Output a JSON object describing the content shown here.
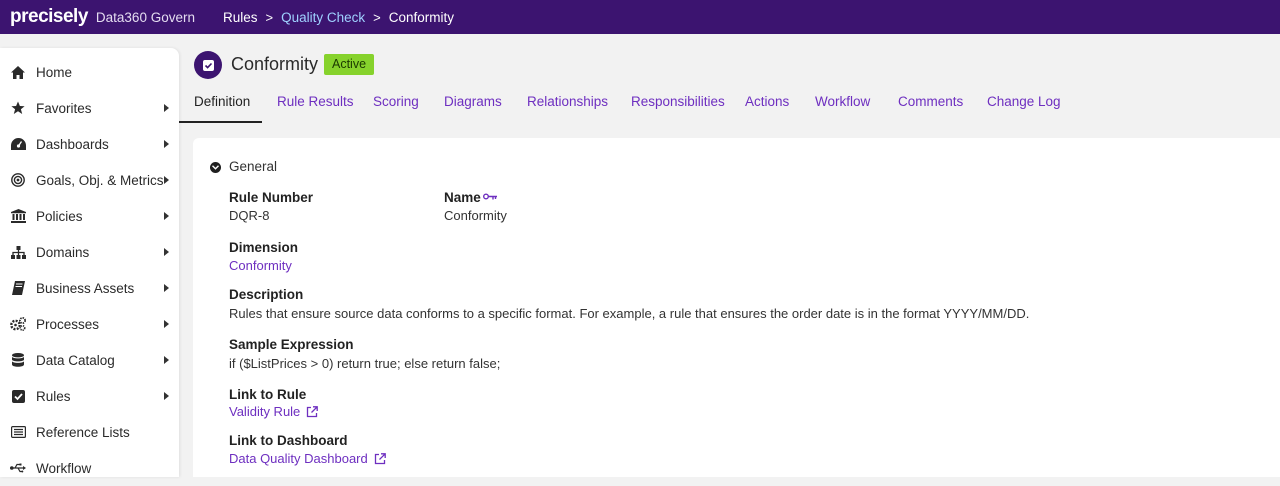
{
  "topbar": {
    "logo": "precisely",
    "product": "Data360 Govern",
    "breadcrumbs": [
      {
        "label": "Rules"
      },
      {
        "label": "Quality Check"
      },
      {
        "label": "Conformity"
      }
    ],
    "separator": ">"
  },
  "sidebar": {
    "items": [
      {
        "label": "Home",
        "icon": "home-icon",
        "has_submenu": false
      },
      {
        "label": "Favorites",
        "icon": "star-icon",
        "has_submenu": true
      },
      {
        "label": "Dashboards",
        "icon": "dashboard-icon",
        "has_submenu": true
      },
      {
        "label": "Goals, Obj. & Metrics",
        "icon": "target-icon",
        "has_submenu": true
      },
      {
        "label": "Policies",
        "icon": "bank-icon",
        "has_submenu": true
      },
      {
        "label": "Domains",
        "icon": "hierarchy-icon",
        "has_submenu": true
      },
      {
        "label": "Business Assets",
        "icon": "book-icon",
        "has_submenu": true
      },
      {
        "label": "Processes",
        "icon": "gears-icon",
        "has_submenu": true
      },
      {
        "label": "Data Catalog",
        "icon": "database-icon",
        "has_submenu": true
      },
      {
        "label": "Rules",
        "icon": "checkbox-icon",
        "has_submenu": true
      },
      {
        "label": "Reference Lists",
        "icon": "list-icon",
        "has_submenu": false
      },
      {
        "label": "Workflow",
        "icon": "usb-icon",
        "has_submenu": false
      }
    ]
  },
  "header": {
    "title": "Conformity",
    "status": "Active",
    "icon": "checkbox-icon"
  },
  "tabs": [
    {
      "label": "Definition",
      "active": true
    },
    {
      "label": "Rule Results",
      "active": false
    },
    {
      "label": "Scoring",
      "active": false
    },
    {
      "label": "Diagrams",
      "active": false
    },
    {
      "label": "Relationships",
      "active": false
    },
    {
      "label": "Responsibilities",
      "active": false
    },
    {
      "label": "Actions",
      "active": false
    },
    {
      "label": "Workflow",
      "active": false
    },
    {
      "label": "Comments",
      "active": false
    },
    {
      "label": "Change Log",
      "active": false
    }
  ],
  "general": {
    "section_title": "General",
    "rule_number_label": "Rule Number",
    "rule_number": "DQR-8",
    "name_label": "Name",
    "name": "Conformity",
    "dimension_label": "Dimension",
    "dimension": "Conformity",
    "description_label": "Description",
    "description": "Rules that ensure source data conforms to a specific format. For example, a rule that ensures the order date is in the format YYYY/MM/DD.",
    "sample_expression_label": "Sample Expression",
    "sample_expression": "if ($ListPrices > 0) return true; else return false;",
    "link_to_rule_label": "Link to Rule",
    "link_to_rule": "Validity Rule",
    "link_to_dashboard_label": "Link to Dashboard",
    "link_to_dashboard": "Data Quality Dashboard"
  },
  "colors": {
    "topbar": "#3c1470",
    "link": "#6e2fc0",
    "active_badge": "#86d22c",
    "breadcrumb_link": "#9fd1ff"
  }
}
